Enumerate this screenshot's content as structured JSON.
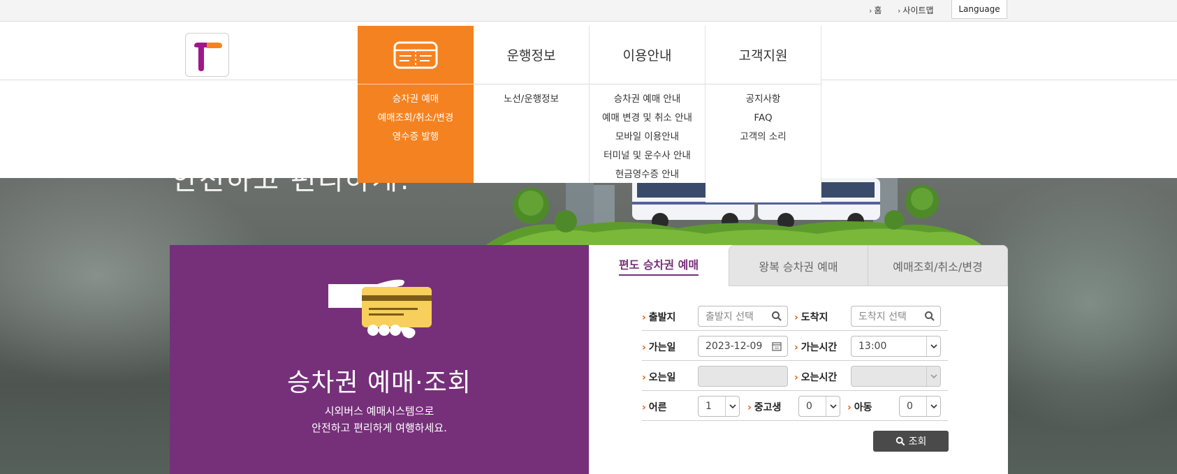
{
  "util": {
    "home": "홈",
    "sitemap": "사이트맵",
    "language": "Language"
  },
  "nav": {
    "menus": [
      {
        "label": "",
        "items": [
          "승차권 예매",
          "예매조회/취소/변경",
          "영수증 발행"
        ]
      },
      {
        "label": "운행정보",
        "items": [
          "노선/운행정보"
        ]
      },
      {
        "label": "이용안내",
        "items": [
          "승차권 예매 안내",
          "예매 변경 및 취소 안내",
          "모바일 이용안내",
          "터미널 및 운수사 안내",
          "현금영수증 안내"
        ]
      },
      {
        "label": "고객지원",
        "items": [
          "공지사항",
          "FAQ",
          "고객의 소리"
        ]
      }
    ]
  },
  "hero": {
    "title": "안전하고 편리하게!"
  },
  "promo": {
    "title": "승차권 예매·조회",
    "desc_line1": "시외버스 예매시스템으로",
    "desc_line2": "안전하고 편리하게 여행하세요."
  },
  "booking": {
    "tabs": [
      "편도 승차권 예매",
      "왕복 승차권 예매",
      "예매조회/취소/변경"
    ],
    "depart_label": "출발지",
    "depart_placeholder": "출발지 선택",
    "arrive_label": "도착지",
    "arrive_placeholder": "도착지 선택",
    "go_date_label": "가는일",
    "go_date_value": "2023-12-09",
    "go_time_label": "가는시간",
    "go_time_value": "13:00",
    "return_date_label": "오는일",
    "return_date_value": "",
    "return_time_label": "오는시간",
    "return_time_value": "",
    "adult_label": "어른",
    "adult_value": "1",
    "teen_label": "중고생",
    "teen_value": "0",
    "child_label": "아동",
    "child_value": "0",
    "search_label": "조회"
  },
  "colors": {
    "accent_orange": "#f58220",
    "brand_purple": "#76307a",
    "arrow_orange": "#e35d13",
    "search_button": "#4a4a4a"
  }
}
